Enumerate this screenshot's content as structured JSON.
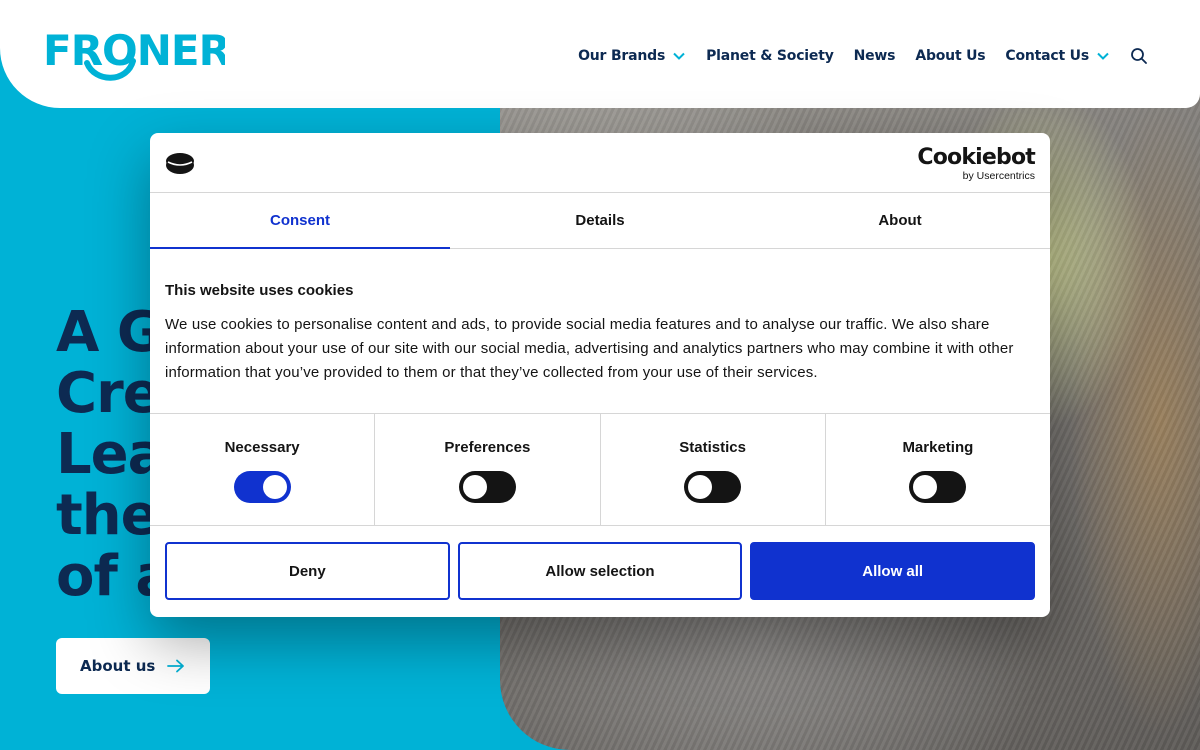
{
  "site": {
    "logo_text": "FRONERI",
    "nav": {
      "items": [
        {
          "label": "Our Brands",
          "has_dropdown": true
        },
        {
          "label": "Planet & Society",
          "has_dropdown": false
        },
        {
          "label": "News",
          "has_dropdown": false
        },
        {
          "label": "About Us",
          "has_dropdown": false
        },
        {
          "label": "Contact Us",
          "has_dropdown": true
        }
      ],
      "search_icon": "search-icon"
    },
    "hero": {
      "title_lines": [
        "A G",
        "Cre",
        "Lea",
        "the",
        "of a"
      ],
      "cta_label": "About us",
      "cta_icon": "arrow-right-icon"
    },
    "colors": {
      "brand_cyan": "#00b2d6",
      "navy": "#0d2a52",
      "white": "#ffffff"
    }
  },
  "cookie_dialog": {
    "brand": {
      "name": "Cookiebot",
      "sub": "by Usercentrics"
    },
    "tabs": [
      {
        "label": "Consent",
        "active": true
      },
      {
        "label": "Details",
        "active": false
      },
      {
        "label": "About",
        "active": false
      }
    ],
    "heading": "This website uses cookies",
    "body": "We use cookies to personalise content and ads, to provide social media features and to analyse our traffic. We also share information about your use of our site with our social media, advertising and analytics partners who may combine it with other information that you’ve provided to them or that they’ve collected from your use of their services.",
    "toggles": [
      {
        "label": "Necessary",
        "on": true
      },
      {
        "label": "Preferences",
        "on": false
      },
      {
        "label": "Statistics",
        "on": false
      },
      {
        "label": "Marketing",
        "on": false
      }
    ],
    "buttons": {
      "deny": "Deny",
      "allow_selection": "Allow selection",
      "allow_all": "Allow all"
    },
    "colors": {
      "accent": "#1032cf",
      "toggle_off": "#141414"
    }
  }
}
